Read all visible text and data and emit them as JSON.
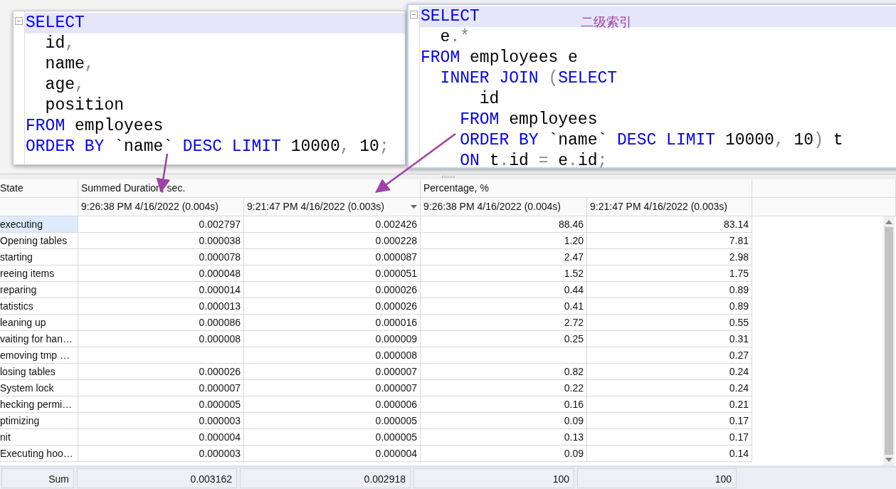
{
  "popups": [
    {
      "lines": [
        {
          "highlighted": true,
          "tokens": [
            {
              "kind": "keyword",
              "text": "SELECT"
            }
          ]
        },
        {
          "highlighted": false,
          "tokens": [
            {
              "kind": "ident",
              "text": "  id"
            },
            {
              "kind": "punct",
              "text": ","
            }
          ]
        },
        {
          "highlighted": false,
          "tokens": [
            {
              "kind": "ident",
              "text": "  name"
            },
            {
              "kind": "punct",
              "text": ","
            }
          ]
        },
        {
          "highlighted": false,
          "tokens": [
            {
              "kind": "ident",
              "text": "  age"
            },
            {
              "kind": "punct",
              "text": ","
            }
          ]
        },
        {
          "highlighted": false,
          "tokens": [
            {
              "kind": "ident",
              "text": "  position"
            }
          ]
        },
        {
          "highlighted": false,
          "tokens": [
            {
              "kind": "keyword",
              "text": "FROM"
            },
            {
              "kind": "ident",
              "text": " employees"
            }
          ]
        },
        {
          "highlighted": false,
          "tokens": [
            {
              "kind": "keyword",
              "text": "ORDER BY"
            },
            {
              "kind": "ident",
              "text": " `name` "
            },
            {
              "kind": "keyword",
              "text": "DESC LIMIT"
            },
            {
              "kind": "ident",
              "text": " 10000"
            },
            {
              "kind": "punct",
              "text": ","
            },
            {
              "kind": "ident",
              "text": " 10"
            },
            {
              "kind": "punct",
              "text": ";"
            }
          ]
        }
      ]
    },
    {
      "lines": [
        {
          "highlighted": true,
          "tokens": [
            {
              "kind": "keyword",
              "text": "SELECT"
            }
          ]
        },
        {
          "highlighted": false,
          "tokens": [
            {
              "kind": "ident",
              "text": "  e"
            },
            {
              "kind": "punct",
              "text": ".*"
            }
          ]
        },
        {
          "highlighted": false,
          "tokens": [
            {
              "kind": "keyword",
              "text": "FROM"
            },
            {
              "kind": "ident",
              "text": " employees e"
            }
          ]
        },
        {
          "highlighted": false,
          "tokens": [
            {
              "kind": "keyword",
              "text": "  INNER JOIN "
            },
            {
              "kind": "punct",
              "text": "("
            },
            {
              "kind": "keyword",
              "text": "SELECT"
            }
          ]
        },
        {
          "highlighted": false,
          "tokens": [
            {
              "kind": "ident",
              "text": "      id"
            }
          ]
        },
        {
          "highlighted": false,
          "tokens": [
            {
              "kind": "keyword",
              "text": "    FROM"
            },
            {
              "kind": "ident",
              "text": " employees"
            }
          ]
        },
        {
          "highlighted": false,
          "tokens": [
            {
              "kind": "keyword",
              "text": "    ORDER BY"
            },
            {
              "kind": "ident",
              "text": " `name` "
            },
            {
              "kind": "keyword",
              "text": "DESC LIMIT"
            },
            {
              "kind": "ident",
              "text": " 10000"
            },
            {
              "kind": "punct",
              "text": ","
            },
            {
              "kind": "ident",
              "text": " 10"
            },
            {
              "kind": "punct",
              "text": ")"
            },
            {
              "kind": "ident",
              "text": " t"
            }
          ]
        },
        {
          "highlighted": false,
          "tokens": [
            {
              "kind": "keyword",
              "text": "    ON"
            },
            {
              "kind": "ident",
              "text": " t"
            },
            {
              "kind": "punct",
              "text": "."
            },
            {
              "kind": "ident",
              "text": "id "
            },
            {
              "kind": "punct",
              "text": "="
            },
            {
              "kind": "ident",
              "text": " e"
            },
            {
              "kind": "punct",
              "text": "."
            },
            {
              "kind": "ident",
              "text": "id"
            },
            {
              "kind": "punct",
              "text": ";"
            }
          ]
        }
      ]
    }
  ],
  "annotation": "二级索引",
  "grid": {
    "group_headers": [
      "State",
      "Summed Duration, sec.",
      "Percentage, %"
    ],
    "subheaders": [
      {
        "label": "9:26:38 PM 4/16/2022 (0.004s)",
        "dropdown": false
      },
      {
        "label": "9:21:47 PM 4/16/2022 (0.003s)",
        "dropdown": true
      },
      {
        "label": "9:26:38 PM 4/16/2022 (0.004s)",
        "dropdown": false
      },
      {
        "label": "9:21:47 PM 4/16/2022 (0.003s)",
        "dropdown": false
      }
    ],
    "rows": [
      {
        "state": "executing",
        "selected": true,
        "values": [
          "0.002797",
          "0.002426",
          "88.46",
          "83.14"
        ]
      },
      {
        "state": "Opening tables",
        "selected": false,
        "values": [
          "0.000038",
          "0.000228",
          "1.20",
          "7.81"
        ]
      },
      {
        "state": "starting",
        "selected": false,
        "values": [
          "0.000078",
          "0.000087",
          "2.47",
          "2.98"
        ]
      },
      {
        "state": "reeing items",
        "selected": false,
        "values": [
          "0.000048",
          "0.000051",
          "1.52",
          "1.75"
        ]
      },
      {
        "state": "reparing",
        "selected": false,
        "values": [
          "0.000014",
          "0.000026",
          "0.44",
          "0.89"
        ]
      },
      {
        "state": "tatistics",
        "selected": false,
        "values": [
          "0.000013",
          "0.000026",
          "0.41",
          "0.89"
        ]
      },
      {
        "state": "leaning up",
        "selected": false,
        "values": [
          "0.000086",
          "0.000016",
          "2.72",
          "0.55"
        ]
      },
      {
        "state": "vaiting for han…",
        "selected": false,
        "values": [
          "0.000008",
          "0.000009",
          "0.25",
          "0.31"
        ]
      },
      {
        "state": "emoving tmp …",
        "selected": false,
        "cells": {
          "duration_2": "0.000008",
          "percent_2": "0.27"
        }
      },
      {
        "state": "losing tables",
        "selected": false,
        "values": [
          "0.000026",
          "0.000007",
          "0.82",
          "0.24"
        ]
      },
      {
        "state": "System lock",
        "selected": false,
        "values": [
          "0.000007",
          "0.000007",
          "0.22",
          "0.24"
        ]
      },
      {
        "state": "hecking permi…",
        "selected": false,
        "values": [
          "0.000005",
          "0.000006",
          "0.16",
          "0.21"
        ]
      },
      {
        "state": "ptimizing",
        "selected": false,
        "values": [
          "0.000003",
          "0.000005",
          "0.09",
          "0.17"
        ]
      },
      {
        "state": "nit",
        "selected": false,
        "values": [
          "0.000004",
          "0.000005",
          "0.13",
          "0.17"
        ]
      },
      {
        "state": "Executing hoo…",
        "selected": false,
        "values": [
          "0.000003",
          "0.000004",
          "0.09",
          "0.14"
        ]
      }
    ],
    "sum": {
      "label": "Sum",
      "values": [
        "0.003162",
        "0.002918",
        "100",
        "100"
      ]
    }
  }
}
